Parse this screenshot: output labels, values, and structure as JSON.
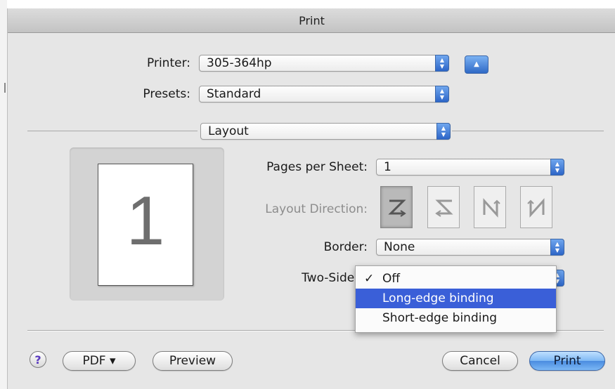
{
  "window": {
    "title": "Print"
  },
  "printer": {
    "label": "Printer:",
    "value": "305-364hp"
  },
  "presets": {
    "label": "Presets:",
    "value": "Standard"
  },
  "panel": {
    "value": "Layout"
  },
  "preview": {
    "page_number": "1"
  },
  "pages_per_sheet": {
    "label": "Pages per Sheet:",
    "value": "1"
  },
  "layout_direction": {
    "label": "Layout Direction:",
    "options": [
      "z-order-icon",
      "reverse-z-order-icon",
      "n-order-icon",
      "reverse-n-order-icon"
    ],
    "selected_index": 0
  },
  "border": {
    "label": "Border:",
    "value": "None"
  },
  "two_sided": {
    "label": "Two-Sided",
    "menu": [
      {
        "label": "Off",
        "checked": true
      },
      {
        "label": "Long-edge binding",
        "highlighted": true
      },
      {
        "label": "Short-edge binding"
      }
    ]
  },
  "footer": {
    "help": "?",
    "pdf": "PDF ▾",
    "preview": "Preview",
    "cancel": "Cancel",
    "print": "Print"
  },
  "colors": {
    "accent": "#3a5fd8",
    "default_button": "#7fb8f4"
  }
}
